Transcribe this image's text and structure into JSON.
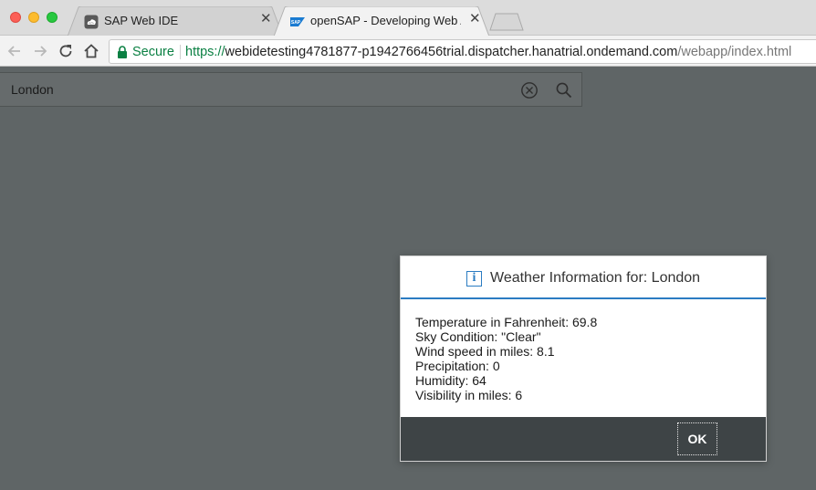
{
  "browser": {
    "tabs": [
      {
        "title": "SAP Web IDE",
        "close": "✕",
        "active": false
      },
      {
        "title": "openSAP - Developing Web Apps",
        "close": "✕",
        "active": true
      }
    ],
    "security_label": "Secure",
    "url": {
      "scheme": "https://",
      "host": "webidetesting4781877-p1942766456trial.dispatcher.hanatrial.ondemand.com",
      "path": "/webapp/index.html"
    }
  },
  "search": {
    "value": "London",
    "clear_icon": "clear-circle-icon",
    "search_icon": "search-icon"
  },
  "dialog": {
    "icon_glyph": "i",
    "title": "Weather Information for: London",
    "lines": [
      "Temperature in Fahrenheit: 69.8",
      "Sky Condition: \"Clear\"",
      "Wind speed in miles: 8.1",
      "Precipitation: 0",
      "Humidity: 64",
      "Visibility in miles: 6"
    ],
    "ok_label": "OK"
  },
  "colors": {
    "accent": "#2b7cc2",
    "secure_green": "#0b8043",
    "page_backdrop": "#5f6566",
    "dialog_footer": "#3e4446"
  }
}
